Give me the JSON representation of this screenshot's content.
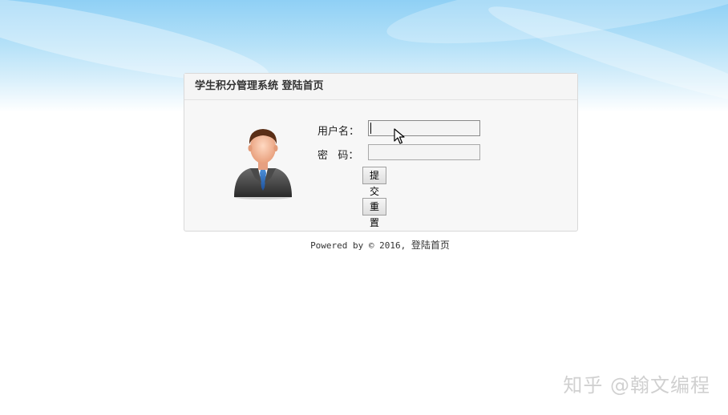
{
  "card": {
    "title": "学生积分管理系统 登陆首页"
  },
  "form": {
    "username_label": "用户名：",
    "username_value": "",
    "password_label": "密   码：",
    "password_value": "",
    "submit_label": "提交",
    "reset_label": "重置"
  },
  "footer": {
    "prefix": "Powered by © 2016,",
    "site": "登陆首页"
  },
  "watermark": "知乎 @翰文编程",
  "icons": {
    "avatar": "user-avatar-icon",
    "cursor": "mouse-pointer-icon"
  },
  "colors": {
    "sky_top": "#8fd0f5",
    "card_bg": "#f7f7f7",
    "card_border": "#d9d9d9"
  }
}
